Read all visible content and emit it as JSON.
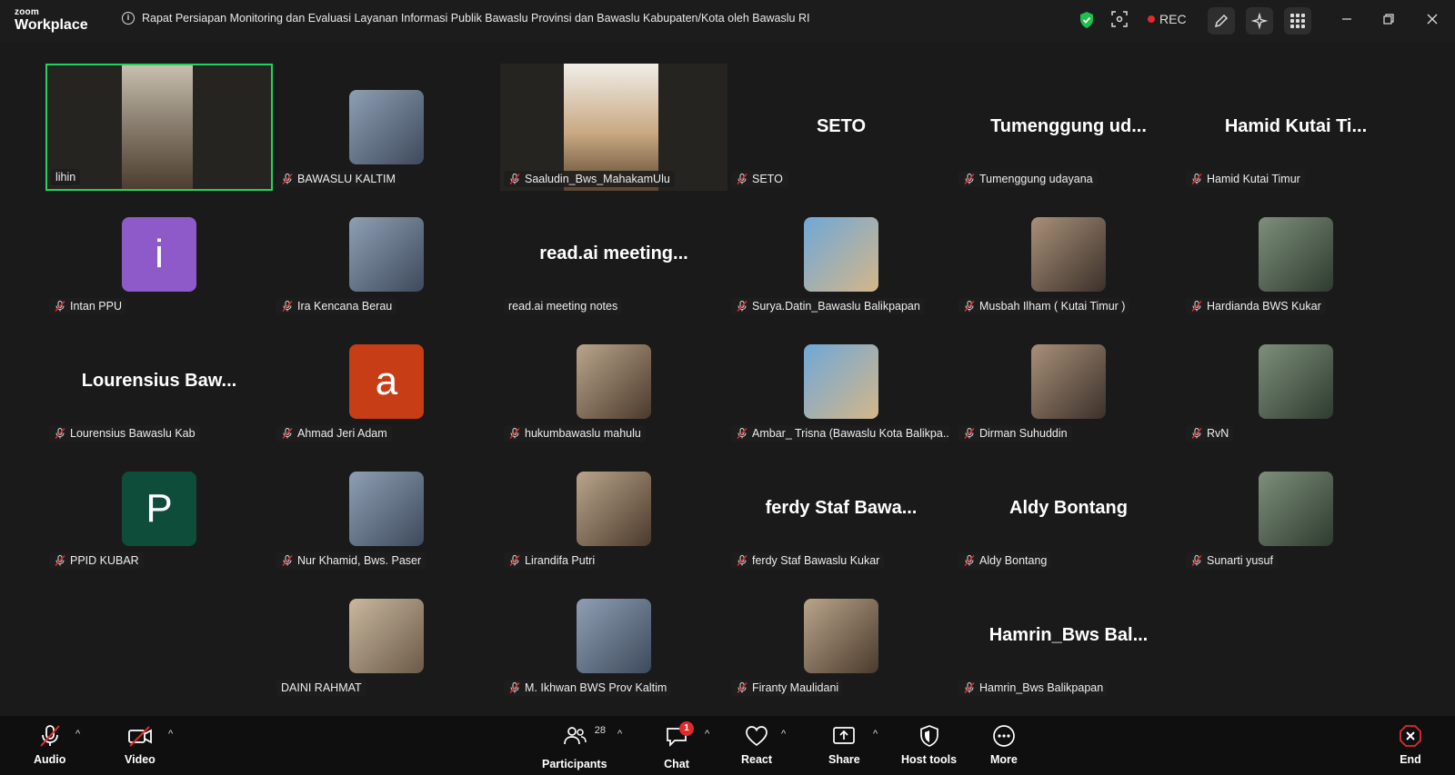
{
  "app": {
    "brand_top": "zoom",
    "brand_bottom": "Workplace"
  },
  "meeting": {
    "title": "Rapat Persiapan Monitoring dan Evaluasi Layanan Informasi Publik Bawaslu Provinsi dan Bawaslu Kabupaten/Kota oleh Bawaslu RI",
    "rec_label": "REC"
  },
  "participants": [
    {
      "name": "lihin",
      "type": "video",
      "muted": false,
      "active": true
    },
    {
      "name": "BAWASLU KALTIM",
      "type": "image",
      "muted": true
    },
    {
      "name": "Saaludin_Bws_MahakamUlu",
      "type": "video",
      "muted": true
    },
    {
      "name": "SETO",
      "display": "SETO",
      "type": "text",
      "muted": true
    },
    {
      "name": "Tumenggung udayana",
      "display": "Tumenggung  ud...",
      "type": "text",
      "muted": true
    },
    {
      "name": "Hamid Kutai Timur",
      "display": "Hamid Kutai Ti...",
      "type": "text",
      "muted": true
    },
    {
      "name": "Intan PPU",
      "type": "letter",
      "letter": "i",
      "color": "#8e5ac9",
      "muted": true
    },
    {
      "name": "Ira Kencana Berau",
      "type": "image",
      "muted": true
    },
    {
      "name": "read.ai meeting notes",
      "display": "read.ai  meeting...",
      "type": "text",
      "muted": false
    },
    {
      "name": "Surya.Datin_Bawaslu Balikpapan",
      "type": "image",
      "muted": true
    },
    {
      "name": "Musbah Ilham  ( Kutai Timur )",
      "type": "image",
      "muted": true
    },
    {
      "name": "Hardianda BWS Kukar",
      "type": "image",
      "muted": true
    },
    {
      "name": "Lourensius Bawaslu Kab",
      "display": "Lourensius  Baw...",
      "type": "text",
      "muted": true
    },
    {
      "name": "Ahmad Jeri Adam",
      "type": "letter",
      "letter": "a",
      "color": "#c63d16",
      "muted": true
    },
    {
      "name": "hukumbawaslu mahulu",
      "type": "image",
      "muted": true
    },
    {
      "name": "Ambar_ Trisna (Bawaslu Kota Balikpa...",
      "type": "image",
      "muted": true
    },
    {
      "name": "Dirman Suhuddin",
      "type": "image",
      "muted": true
    },
    {
      "name": "RvN",
      "type": "image",
      "muted": true
    },
    {
      "name": "PPID KUBAR",
      "type": "letter",
      "letter": "P",
      "color": "#0d4d3a",
      "muted": true
    },
    {
      "name": "Nur Khamid, Bws. Paser",
      "type": "image",
      "muted": true
    },
    {
      "name": "Lirandifa Putri",
      "type": "image",
      "muted": true
    },
    {
      "name": "ferdy Staf Bawaslu Kukar",
      "display": "ferdy  Staf  Bawa...",
      "type": "text",
      "muted": true
    },
    {
      "name": "Aldy Bontang",
      "display": "Aldy Bontang",
      "type": "text",
      "muted": true
    },
    {
      "name": "Sunarti yusuf",
      "type": "image",
      "muted": true
    },
    {
      "name": "DAINI RAHMAT",
      "type": "image",
      "muted": false
    },
    {
      "name": "M. Ikhwan BWS Prov Kaltim",
      "type": "image",
      "muted": true
    },
    {
      "name": "Firanty Maulidani",
      "type": "image",
      "muted": true
    },
    {
      "name": "Hamrin_Bws Balikpapan",
      "display": "Hamrin_Bws  Bal...",
      "type": "text",
      "muted": true
    }
  ],
  "toolbar": {
    "audio": "Audio",
    "video": "Video",
    "participants": "Participants",
    "participant_count": "28",
    "chat": "Chat",
    "chat_badge": "1",
    "react": "React",
    "share": "Share",
    "host_tools": "Host tools",
    "more": "More",
    "end": "End"
  },
  "colors": {
    "active_speaker": "#22d35d",
    "end": "#e02b2b",
    "shield": "#1fbf4e"
  }
}
